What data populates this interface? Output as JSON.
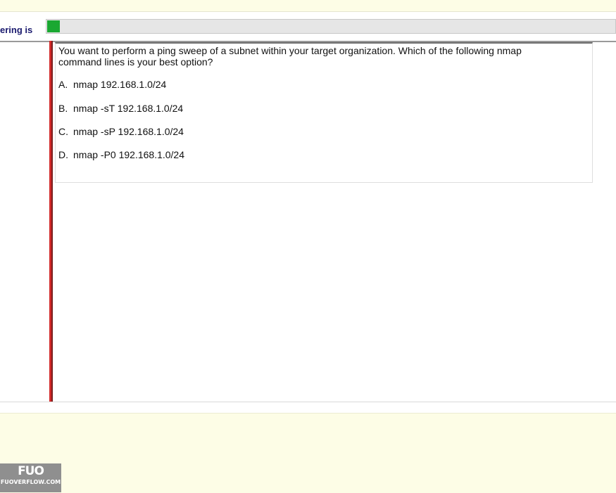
{
  "header": {
    "label": "ering is",
    "progress_fraction": 0.022,
    "progress_color": "#1aa832"
  },
  "question": {
    "text": "You want to perform a ping sweep of a subnet within your target organization. Which of the following nmap command lines is your best option?",
    "options": [
      {
        "letter": "A.",
        "text": "nmap 192.168.1.0/24"
      },
      {
        "letter": "B.",
        "text": "nmap -sT 192.168.1.0/24"
      },
      {
        "letter": "C.",
        "text": "nmap -sP 192.168.1.0/24"
      },
      {
        "letter": "D.",
        "text": "nmap -P0 192.168.1.0/24"
      }
    ]
  },
  "colors": {
    "page_band": "#fdfde6",
    "accent_bar": "#d32a2a"
  },
  "watermark": {
    "logo": "FUO",
    "site": "FUOVERFLOW.COM"
  }
}
